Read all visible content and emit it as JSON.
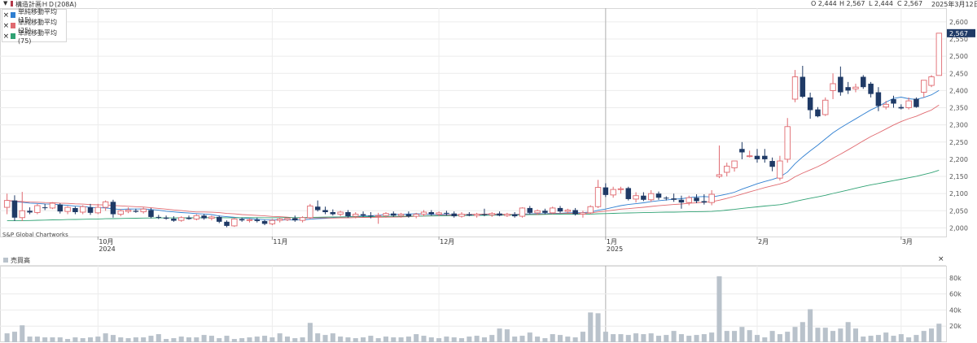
{
  "header": {
    "title": "構造計画ＨＤ(208A)",
    "open": "O 2,444",
    "high": "H 2,567",
    "low": "L 2,444",
    "close": "C 2,567",
    "date": "2025年3月12日"
  },
  "legend": [
    {
      "label": "単純移動平均 (15)",
      "color": "#2f7fd1"
    },
    {
      "label": "単純移動平均 (25)",
      "color": "#e06a70"
    },
    {
      "label": "単純移動平均 (75)",
      "color": "#30a274"
    }
  ],
  "watermark": "S&P Global Chartworks",
  "volume_panel": {
    "title": "売買高",
    "close_icon": "×"
  },
  "colors": {
    "up": "#e06a70",
    "down": "#1f3a66",
    "volume": "#b9c2cb",
    "price_tag": "#1f3a66"
  },
  "chart_data": [
    {
      "type": "candlestick",
      "ylim": [
        1975,
        2640
      ],
      "y_ticks": [
        "2,000",
        "2,050",
        "2,100",
        "2,150",
        "2,200",
        "2,250",
        "2,300",
        "2,350",
        "2,400",
        "2,450",
        "2,500",
        "2,550",
        "2,600"
      ],
      "x_ticks": [
        {
          "label": "10月",
          "sub": "2024",
          "index": 12
        },
        {
          "label": "11月",
          "sub": "",
          "index": 35
        },
        {
          "label": "12月",
          "sub": "",
          "index": 57
        },
        {
          "label": "1月",
          "sub": "2025",
          "index": 79
        },
        {
          "label": "2月",
          "sub": "",
          "index": 99
        },
        {
          "label": "3月",
          "sub": "",
          "index": 118
        }
      ],
      "last_price_label": "2,567",
      "candles": [
        [
          2060,
          2100,
          2040,
          2080
        ],
        [
          2080,
          2095,
          2020,
          2030
        ],
        [
          2030,
          2105,
          2020,
          2050
        ],
        [
          2050,
          2060,
          2040,
          2045
        ],
        [
          2045,
          2070,
          2040,
          2065
        ],
        [
          2060,
          2070,
          2052,
          2058
        ],
        [
          2058,
          2075,
          2055,
          2072
        ],
        [
          2068,
          2072,
          2042,
          2048
        ],
        [
          2048,
          2064,
          2040,
          2060
        ],
        [
          2058,
          2062,
          2040,
          2046
        ],
        [
          2046,
          2066,
          2040,
          2062
        ],
        [
          2060,
          2070,
          2038,
          2044
        ],
        [
          2044,
          2070,
          2040,
          2060
        ],
        [
          2060,
          2080,
          2050,
          2076
        ],
        [
          2076,
          2082,
          2030,
          2040
        ],
        [
          2040,
          2055,
          2034,
          2050
        ],
        [
          2048,
          2060,
          2043,
          2052
        ],
        [
          2050,
          2056,
          2044,
          2047
        ],
        [
          2047,
          2060,
          2042,
          2055
        ],
        [
          2052,
          2058,
          2028,
          2032
        ],
        [
          2032,
          2038,
          2026,
          2030
        ],
        [
          2030,
          2036,
          2024,
          2027
        ],
        [
          2027,
          2034,
          2018,
          2021
        ],
        [
          2022,
          2034,
          2018,
          2030
        ],
        [
          2030,
          2036,
          2024,
          2026
        ],
        [
          2026,
          2040,
          2022,
          2036
        ],
        [
          2036,
          2040,
          2024,
          2028
        ],
        [
          2028,
          2036,
          2022,
          2032
        ],
        [
          2032,
          2036,
          2014,
          2018
        ],
        [
          2018,
          2022,
          2002,
          2006
        ],
        [
          2006,
          2030,
          2003,
          2026
        ],
        [
          2026,
          2030,
          2018,
          2022
        ],
        [
          2022,
          2028,
          2016,
          2024
        ],
        [
          2024,
          2030,
          2016,
          2020
        ],
        [
          2020,
          2024,
          2008,
          2012
        ],
        [
          2012,
          2026,
          2008,
          2022
        ],
        [
          2022,
          2030,
          2016,
          2026
        ],
        [
          2024,
          2030,
          2020,
          2028
        ],
        [
          2028,
          2036,
          2018,
          2022
        ],
        [
          2022,
          2034,
          2016,
          2030
        ],
        [
          2030,
          2070,
          2026,
          2064
        ],
        [
          2062,
          2080,
          2048,
          2052
        ],
        [
          2052,
          2062,
          2040,
          2046
        ],
        [
          2046,
          2054,
          2036,
          2040
        ],
        [
          2040,
          2050,
          2034,
          2046
        ],
        [
          2046,
          2052,
          2030,
          2034
        ],
        [
          2034,
          2046,
          2028,
          2040
        ],
        [
          2040,
          2048,
          2032,
          2036
        ],
        [
          2036,
          2046,
          2028,
          2034
        ],
        [
          2034,
          2044,
          2012,
          2036
        ],
        [
          2036,
          2046,
          2030,
          2042
        ],
        [
          2042,
          2048,
          2032,
          2036
        ],
        [
          2036,
          2044,
          2030,
          2040
        ],
        [
          2040,
          2048,
          2030,
          2034
        ],
        [
          2034,
          2044,
          2028,
          2040
        ],
        [
          2040,
          2052,
          2034,
          2046
        ],
        [
          2046,
          2052,
          2036,
          2040
        ],
        [
          2040,
          2048,
          2034,
          2044
        ],
        [
          2044,
          2050,
          2036,
          2042
        ],
        [
          2042,
          2048,
          2030,
          2034
        ],
        [
          2034,
          2046,
          2030,
          2040
        ],
        [
          2040,
          2046,
          2034,
          2036
        ],
        [
          2036,
          2044,
          2030,
          2040
        ],
        [
          2040,
          2056,
          2034,
          2038
        ],
        [
          2038,
          2046,
          2032,
          2042
        ],
        [
          2042,
          2048,
          2034,
          2036
        ],
        [
          2036,
          2044,
          2032,
          2040
        ],
        [
          2040,
          2046,
          2030,
          2034
        ],
        [
          2034,
          2060,
          2030,
          2058
        ],
        [
          2058,
          2064,
          2040,
          2044
        ],
        [
          2044,
          2054,
          2038,
          2050
        ],
        [
          2050,
          2056,
          2040,
          2044
        ],
        [
          2044,
          2062,
          2040,
          2058
        ],
        [
          2058,
          2064,
          2044,
          2048
        ],
        [
          2048,
          2056,
          2042,
          2052
        ],
        [
          2052,
          2058,
          2036,
          2040
        ],
        [
          2040,
          2050,
          2030,
          2044
        ],
        [
          2044,
          2066,
          2040,
          2062
        ],
        [
          2062,
          2140,
          2058,
          2118
        ],
        [
          2118,
          2130,
          2090,
          2096
        ],
        [
          2096,
          2120,
          2088,
          2112
        ],
        [
          2112,
          2120,
          2100,
          2114
        ],
        [
          2116,
          2120,
          2080,
          2084
        ],
        [
          2084,
          2104,
          2074,
          2094
        ],
        [
          2094,
          2104,
          2078,
          2082
        ],
        [
          2082,
          2110,
          2076,
          2100
        ],
        [
          2100,
          2106,
          2082,
          2088
        ],
        [
          2088,
          2092,
          2080,
          2086
        ],
        [
          2086,
          2100,
          2076,
          2082
        ],
        [
          2082,
          2094,
          2056,
          2074
        ],
        [
          2074,
          2094,
          2066,
          2088
        ],
        [
          2088,
          2098,
          2072,
          2078
        ],
        [
          2078,
          2098,
          2068,
          2074
        ],
        [
          2074,
          2110,
          2066,
          2098
        ],
        [
          2150,
          2240,
          2145,
          2155
        ],
        [
          2162,
          2190,
          2150,
          2180
        ],
        [
          2175,
          2195,
          2164,
          2195
        ],
        [
          2230,
          2250,
          2200,
          2220
        ],
        [
          2210,
          2225,
          2205,
          2210
        ],
        [
          2210,
          2230,
          2190,
          2200
        ],
        [
          2210,
          2230,
          2190,
          2200
        ],
        [
          2195,
          2205,
          2165,
          2178
        ],
        [
          2145,
          2210,
          2138,
          2195
        ],
        [
          2200,
          2320,
          2190,
          2295
        ],
        [
          2375,
          2460,
          2366,
          2440
        ],
        [
          2440,
          2472,
          2378,
          2382
        ],
        [
          2380,
          2394,
          2318,
          2343
        ],
        [
          2345,
          2352,
          2322,
          2325
        ],
        [
          2330,
          2380,
          2326,
          2372
        ],
        [
          2400,
          2450,
          2375,
          2420
        ],
        [
          2440,
          2470,
          2385,
          2395
        ],
        [
          2410,
          2425,
          2390,
          2400
        ],
        [
          2405,
          2420,
          2395,
          2410
        ],
        [
          2440,
          2445,
          2405,
          2410
        ],
        [
          2420,
          2425,
          2380,
          2390
        ],
        [
          2395,
          2410,
          2340,
          2355
        ],
        [
          2352,
          2370,
          2345,
          2360
        ],
        [
          2375,
          2385,
          2350,
          2362
        ],
        [
          2352,
          2360,
          2345,
          2348
        ],
        [
          2350,
          2380,
          2345,
          2370
        ],
        [
          2376,
          2380,
          2350,
          2352
        ],
        [
          2395,
          2420,
          2380,
          2430
        ],
        [
          2415,
          2445,
          2410,
          2440
        ],
        [
          2444,
          2567,
          2444,
          2567
        ]
      ],
      "sma": [
        {
          "name": "単純移動平均 (15)",
          "period": 15
        },
        {
          "name": "単純移動平均 (25)",
          "period": 25
        },
        {
          "name": "単純移動平均 (75)",
          "period": 75,
          "seed": 2020
        }
      ]
    },
    {
      "type": "bar",
      "name": "売買高",
      "ylim": [
        0,
        95000
      ],
      "y_ticks": [
        "20k",
        "40k",
        "60k",
        "80k"
      ],
      "y_tick_values": [
        20000,
        40000,
        60000,
        80000
      ],
      "values": [
        11000,
        13000,
        21000,
        7000,
        7000,
        6000,
        6000,
        6000,
        4000,
        6000,
        5000,
        6000,
        7000,
        11000,
        9000,
        6000,
        5000,
        6000,
        6000,
        8000,
        10000,
        4000,
        5000,
        7000,
        6000,
        6000,
        9000,
        8000,
        5000,
        8000,
        4000,
        5000,
        6000,
        7000,
        8000,
        6000,
        11000,
        7000,
        5000,
        6000,
        24000,
        11000,
        9000,
        11000,
        7000,
        6000,
        5000,
        6000,
        8000,
        5000,
        7000,
        6000,
        6000,
        7000,
        10000,
        8000,
        6000,
        5000,
        7000,
        6000,
        5000,
        7000,
        8000,
        6000,
        9000,
        17000,
        16000,
        7000,
        8000,
        12000,
        7000,
        5000,
        10000,
        9000,
        7000,
        6000,
        13000,
        37000,
        36000,
        13000,
        10000,
        10000,
        9000,
        11000,
        10000,
        11000,
        8000,
        9000,
        14000,
        10000,
        8000,
        9000,
        10000,
        12000,
        82000,
        14000,
        14000,
        19000,
        15000,
        9000,
        6000,
        14000,
        10000,
        13000,
        19000,
        25000,
        41000,
        18000,
        18000,
        14000,
        17000,
        25000,
        17000,
        7000,
        8000,
        9000,
        12000,
        8000,
        10000,
        6000,
        9000,
        14000,
        17000,
        23000
      ]
    }
  ]
}
